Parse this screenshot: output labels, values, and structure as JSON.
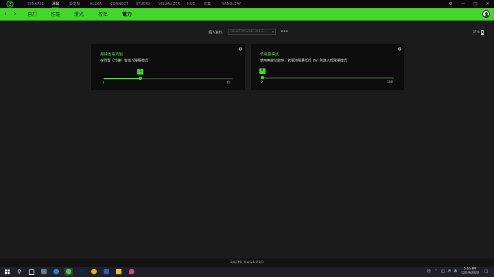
{
  "topnav": {
    "items": [
      {
        "label": "SYNAPSE",
        "active": false
      },
      {
        "label": "滑鼠",
        "active": true
      },
      {
        "label": "設定檔",
        "active": false
      },
      {
        "label": "ALEXA",
        "active": false
      },
      {
        "label": "CONNECT",
        "active": false
      },
      {
        "label": "STUDIO",
        "active": false
      },
      {
        "label": "VISUALIZER",
        "active": false
      },
      {
        "label": "HUE",
        "active": false
      },
      {
        "label": "宏集",
        "active": false
      },
      {
        "label": "NANOLEAF",
        "active": false
      }
    ],
    "controls": {
      "settings_icon": "gear-icon",
      "minimize_icon": "minimize-icon",
      "maximize_icon": "maximize-icon",
      "close_icon": "close-icon"
    }
  },
  "subnav": {
    "tabs": [
      {
        "label": "自訂",
        "active": false
      },
      {
        "label": "性能",
        "active": false
      },
      {
        "label": "燈光",
        "active": false
      },
      {
        "label": "校準",
        "active": false
      },
      {
        "label": "電力",
        "active": true
      }
    ]
  },
  "profile": {
    "label": "個人資料",
    "selected": "DESKTOP-S0HO3K8-E...",
    "more": "•••"
  },
  "battery": {
    "percent_text": "37%",
    "level": 0.37
  },
  "cards": [
    {
      "title": "無線省電功能",
      "description": "在閒置（分鐘）後進入睡眠模式",
      "slider": {
        "value": 5,
        "min": 1,
        "max": 15,
        "value_text": "5",
        "min_text": "1",
        "max_text": "15"
      }
    },
    {
      "title": "低電量模式",
      "description": "使用無線功能時，若電池電量低於 (%) 則進入低電量模式",
      "slider": {
        "value": 0,
        "min": 0,
        "max": 100,
        "value_text": "0",
        "min_text": "0",
        "max_text": "100"
      }
    }
  ],
  "device": {
    "name": "RAZER NAGA PRO"
  },
  "colors": {
    "accent": "#44d62c",
    "background": "#1b1b1b",
    "card": "#0d0d0d"
  },
  "taskbar": {
    "time": "5:16 PM",
    "date": "12/19/2020"
  }
}
